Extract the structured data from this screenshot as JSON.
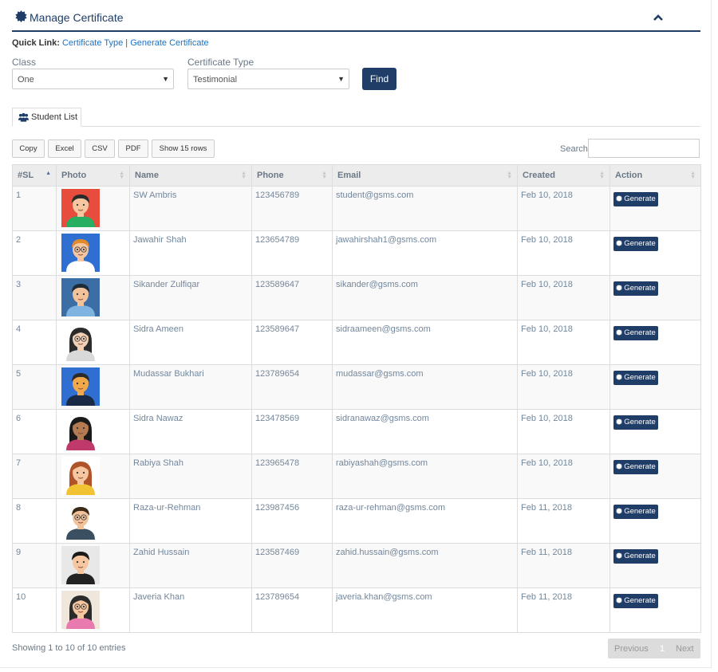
{
  "header": {
    "title": "Manage Certificate",
    "icon": "certificate-icon",
    "collapse_icon": "chevron-up-icon"
  },
  "quick_link": {
    "label": "Quick Link:",
    "links": [
      "Certificate Type",
      "Generate Certificate"
    ],
    "separator": "|"
  },
  "filters": {
    "class_label": "Class",
    "class_value": "One",
    "type_label": "Certificate Type",
    "type_value": "Testimonial",
    "find_label": "Find"
  },
  "tabs": [
    {
      "label": "Student List",
      "icon": "users-icon",
      "active": true
    }
  ],
  "toolbar": {
    "buttons": [
      "Copy",
      "Excel",
      "CSV",
      "PDF",
      "Show 15 rows"
    ],
    "search_label": "Search:",
    "search_value": ""
  },
  "table": {
    "columns": [
      "#SL",
      "Photo",
      "Name",
      "Phone",
      "Email",
      "Created",
      "Action"
    ],
    "sorted_column": "#SL",
    "action_label": "Generate",
    "rows": [
      {
        "sl": "1",
        "name": "SW Ambris",
        "phone": "123456789",
        "email": "student@gsms.com",
        "created": "Feb 10, 2018",
        "photo": "avatar-male-red"
      },
      {
        "sl": "2",
        "name": "Jawahir Shah",
        "phone": "123654789",
        "email": "jawahirshah1@gsms.com",
        "created": "Feb 10, 2018",
        "photo": "avatar-male-glasses-blue"
      },
      {
        "sl": "3",
        "name": "Sikander Zulfiqar",
        "phone": "123589647",
        "email": "sikander@gsms.com",
        "created": "Feb 10, 2018",
        "photo": "avatar-male-dark-blue"
      },
      {
        "sl": "4",
        "name": "Sidra Ameen",
        "phone": "123589647",
        "email": "sidraameen@gsms.com",
        "created": "Feb 10, 2018",
        "photo": "avatar-female-glasses"
      },
      {
        "sl": "5",
        "name": "Mudassar Bukhari",
        "phone": "123789654",
        "email": "mudassar@gsms.com",
        "created": "Feb 10, 2018",
        "photo": "avatar-male-suit-blue"
      },
      {
        "sl": "6",
        "name": "Sidra Nawaz",
        "phone": "123478569",
        "email": "sidranawaz@gsms.com",
        "created": "Feb 10, 2018",
        "photo": "avatar-female-dark"
      },
      {
        "sl": "7",
        "name": "Rabiya Shah",
        "phone": "123965478",
        "email": "rabiyashah@gsms.com",
        "created": "Feb 10, 2018",
        "photo": "avatar-female-red-hair"
      },
      {
        "sl": "8",
        "name": "Raza-ur-Rehman",
        "phone": "123987456",
        "email": "raza-ur-rehman@gsms.com",
        "created": "Feb 11, 2018",
        "photo": "avatar-male-glasses-suit"
      },
      {
        "sl": "9",
        "name": "Zahid Hussain",
        "phone": "123587469",
        "email": "zahid.hussain@gsms.com",
        "created": "Feb 11, 2018",
        "photo": "avatar-male-tie"
      },
      {
        "sl": "10",
        "name": "Javeria Khan",
        "phone": "123789654",
        "email": "javeria.khan@gsms.com",
        "created": "Feb 11, 2018",
        "photo": "avatar-female-glasses-pink"
      }
    ]
  },
  "footer": {
    "info": "Showing 1 to 10 of 10 entries",
    "prev_label": "Previous",
    "page": "1",
    "next_label": "Next"
  },
  "colors": {
    "primary": "#1f3d66",
    "link": "#1b73c6",
    "text": "#73879c"
  }
}
